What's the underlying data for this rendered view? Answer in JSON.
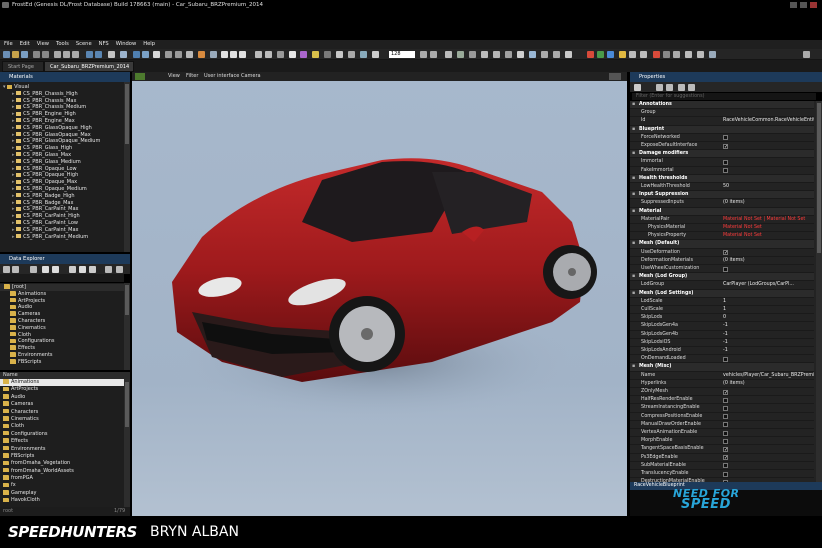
{
  "window_title": "FrostEd (Genesis DL/Frost Database) Build 178663 (main) - Car_Subaru_BRZPremium_2014",
  "menu": [
    "File",
    "Edit",
    "View",
    "Tools",
    "Scene",
    "NFS",
    "Window",
    "Help"
  ],
  "toolbar": {
    "zoom_value": "128"
  },
  "tabs": [
    "Start Page",
    "Car_Subaru_BRZPremium_2014"
  ],
  "materials_panel": {
    "title": "Materials",
    "root": "Visual",
    "items": [
      "CS_PBR_Chassis_High",
      "CS_PBR_Chassis_Max",
      "CS_PBR_Chassis_Medium",
      "CS_PBR_Engine_High",
      "CS_PBR_Engine_Max",
      "CS_PBR_GlassOpaque_High",
      "CS_PBR_GlassOpaque_Max",
      "CS_PBR_GlassOpaque_Medium",
      "CS_PBR_Glass_High",
      "CS_PBR_Glass_Max",
      "CS_PBR_Glass_Medium",
      "CS_PBR_Opaque_Low",
      "CS_PBR_Opaque_High",
      "CS_PBR_Opaque_Max",
      "CS_PBR_Opaque_Medium",
      "CS_PBR_Badge_High",
      "CS_PBR_Badge_Max",
      "CS_PBR_CarPaint_Max",
      "CS_PBR_CarPaint_High",
      "CS_PBR_CarPaint_Low",
      "CS_PBR_CarPaint_Max",
      "CS_PBR_CarPaint_Medium"
    ]
  },
  "data_explorer": {
    "title": "Data Explorer",
    "tree": [
      "[root]",
      "Animations",
      "ArtProjects",
      "Audio",
      "Cameras",
      "Characters",
      "Cinematics",
      "Cloth",
      "Configurations",
      "Effects",
      "Environments",
      "FBScripts"
    ],
    "list_header": "Name",
    "list": [
      "Animations",
      "ArtProjects",
      "Audio",
      "Cameras",
      "Characters",
      "Cinematics",
      "Cloth",
      "Configurations",
      "Effects",
      "Environments",
      "FBScripts",
      "fromOmaha_Vegetation",
      "fromOmaha_WorldAssets",
      "fromPGA",
      "fx",
      "Gameplay",
      "HavokCloth"
    ],
    "footer_left": "root",
    "footer_right": "1/79"
  },
  "viewport": {
    "menu": [
      "View",
      "Filter",
      "User interface",
      "Camera"
    ]
  },
  "properties": {
    "title": "Properties",
    "search_placeholder": "Filter (Enter for suggestions)",
    "rows": [
      {
        "t": "section",
        "label": "Annotations"
      },
      {
        "t": "prop",
        "label": "Group",
        "value": ""
      },
      {
        "t": "prop",
        "label": "Id",
        "value": "RaceVehicleCommon.RaceVehicleEntity"
      },
      {
        "t": "section",
        "label": "Blueprint"
      },
      {
        "t": "check",
        "label": "ForceNetworked",
        "checked": false
      },
      {
        "t": "check",
        "label": "ExposeDefaultInterface",
        "checked": true
      },
      {
        "t": "section",
        "label": "Damage modifiers"
      },
      {
        "t": "check",
        "label": "Immortal",
        "checked": false
      },
      {
        "t": "check",
        "label": "FakeImmortal",
        "checked": false
      },
      {
        "t": "section",
        "label": "Health thresholds"
      },
      {
        "t": "prop",
        "label": "LowHealthThreshold",
        "value": "50"
      },
      {
        "t": "section",
        "label": "Input Suppression"
      },
      {
        "t": "prop",
        "label": "SuppressedInputs",
        "value": "(0 items)"
      },
      {
        "t": "section",
        "label": "Material"
      },
      {
        "t": "prop",
        "label": "MaterialPair",
        "value": "Material Not Set  |  Material Not Set",
        "red": true
      },
      {
        "t": "prop",
        "label": "PhysicsMaterial",
        "value": "Material Not Set",
        "red": true,
        "indent": true
      },
      {
        "t": "prop",
        "label": "PhysicsProperty",
        "value": "Material Not Set",
        "red": true,
        "indent": true
      },
      {
        "t": "section",
        "label": "Mesh (Default)"
      },
      {
        "t": "check",
        "label": "UseDeformation",
        "checked": true
      },
      {
        "t": "prop",
        "label": "DeformationMaterials",
        "value": "(0 items)"
      },
      {
        "t": "check",
        "label": "UseWheelCustomization",
        "checked": false
      },
      {
        "t": "section",
        "label": "Mesh (Lod Group)"
      },
      {
        "t": "prop",
        "label": "LodGroup",
        "value": "CarPlayer (LodGroups/CarPl..."
      },
      {
        "t": "section",
        "label": "Mesh (Lod Settings)"
      },
      {
        "t": "prop",
        "label": "LodScale",
        "value": "1"
      },
      {
        "t": "prop",
        "label": "CullScale",
        "value": "1"
      },
      {
        "t": "prop",
        "label": "SkipLods",
        "value": "0"
      },
      {
        "t": "prop",
        "label": "SkipLodsGen4a",
        "value": "-1"
      },
      {
        "t": "prop",
        "label": "SkipLodsGen4b",
        "value": "-1"
      },
      {
        "t": "prop",
        "label": "SkipLodsiOS",
        "value": "-1"
      },
      {
        "t": "prop",
        "label": "SkipLodsAndroid",
        "value": "-1"
      },
      {
        "t": "check",
        "label": "OnDemandLoaded",
        "checked": false
      },
      {
        "t": "section",
        "label": "Mesh (Misc)"
      },
      {
        "t": "prop",
        "label": "Name",
        "value": "vehicles/Player/Car_Subaru_BRZPremiu"
      },
      {
        "t": "prop",
        "label": "Hyperlinks",
        "value": "(0 items)"
      },
      {
        "t": "check",
        "label": "ZOnlyMesh",
        "checked": true
      },
      {
        "t": "check",
        "label": "HalfResRenderEnable",
        "checked": false
      },
      {
        "t": "check",
        "label": "StreamInstancingEnable",
        "checked": false
      },
      {
        "t": "check",
        "label": "CompressPositionsEnable",
        "checked": false
      },
      {
        "t": "check",
        "label": "ManualDrawOrderEnable",
        "checked": false
      },
      {
        "t": "check",
        "label": "VertexAnimationEnable",
        "checked": false
      },
      {
        "t": "check",
        "label": "MorphEnable",
        "checked": false
      },
      {
        "t": "check",
        "label": "TangentSpaceBasisEnable",
        "checked": true
      },
      {
        "t": "check",
        "label": "Ps3EdgeEnable",
        "checked": true
      },
      {
        "t": "check",
        "label": "SubMaterialEnable",
        "checked": false
      },
      {
        "t": "check",
        "label": "TranslucencyEnable",
        "checked": false
      },
      {
        "t": "check",
        "label": "DestructionMaterialEnable",
        "checked": false
      }
    ],
    "footer": "RaceVehicleBlueprint"
  },
  "watermark": {
    "brand": "SPEEDHUNTERS",
    "author": "BRYN ALBAN",
    "game_logo_line1": "NEED FOR",
    "game_logo_line2": "SPEED"
  },
  "colors": {
    "accent": "#1d3a5a",
    "car_red": "#9e1a1c",
    "viewport_bg": "#a7b8cc"
  }
}
